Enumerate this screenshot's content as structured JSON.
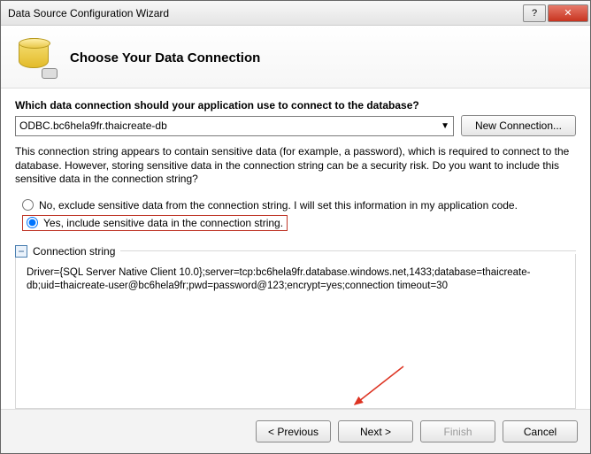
{
  "window": {
    "title": "Data Source Configuration Wizard"
  },
  "header": {
    "heading": "Choose Your Data Connection"
  },
  "question": "Which data connection should your application use to connect to the database?",
  "combo": {
    "value": "ODBC.bc6hela9fr.thaicreate-db"
  },
  "buttons": {
    "new_connection": "New Connection...",
    "previous": "< Previous",
    "next": "Next >",
    "finish": "Finish",
    "cancel": "Cancel"
  },
  "warning": "This connection string appears to contain sensitive data (for example, a password), which is required to connect to the database. However, storing sensitive data in the connection string can be a security risk. Do you want to include this sensitive data in the connection string?",
  "radios": {
    "no": "No, exclude sensitive data from the connection string. I will set this information in my application code.",
    "yes": "Yes, include sensitive data in the connection string."
  },
  "group": {
    "title": "Connection string",
    "value": "Driver={SQL Server Native Client 10.0};server=tcp:bc6hela9fr.database.windows.net,1433;database=thaicreate-db;uid=thaicreate-user@bc6hela9fr;pwd=password@123;encrypt=yes;connection timeout=30"
  }
}
